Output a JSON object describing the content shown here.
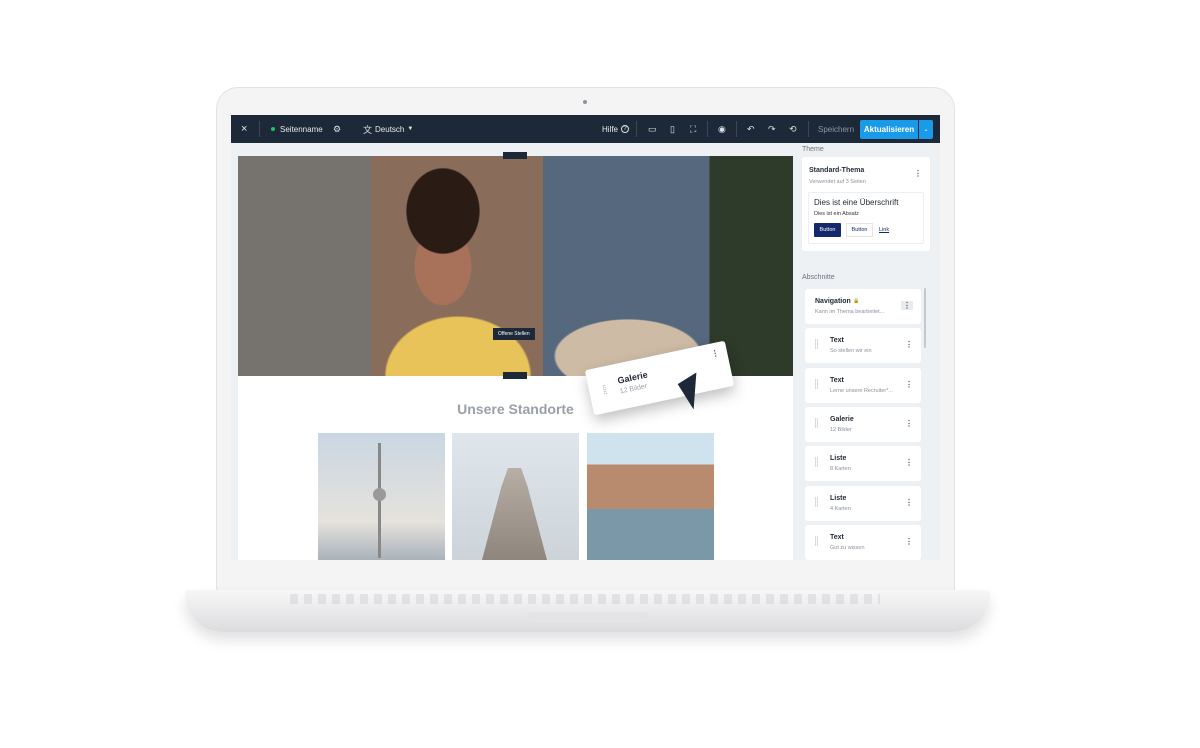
{
  "topbar": {
    "close": "×",
    "page_name": "Seitenname",
    "language": "Deutsch",
    "help": "Hilfe",
    "save": "Speichern",
    "update": "Aktualisieren",
    "status_color": "#22c55e"
  },
  "hero": {
    "tag": "Offene Stellen"
  },
  "content": {
    "heading": "Unsere Standorte"
  },
  "dragging": {
    "title": "Galerie",
    "subtitle": "12 Bilder"
  },
  "sidebar": {
    "theme_label": "Theme",
    "theme": {
      "name": "Standard-Thema",
      "used": "Verwendet auf 3 Seiten",
      "preview_heading": "Dies ist eine Überschrift",
      "preview_paragraph": "Dies ist ein Absatz",
      "primary_button": "Button",
      "secondary_button": "Button",
      "link": "Link"
    },
    "sections_label": "Abschnitte",
    "sections": [
      {
        "title": "Navigation",
        "subtitle": "Kann im Thema bearbeitet..."
      },
      {
        "title": "Text",
        "subtitle": "So stellen wir ein"
      },
      {
        "title": "Text",
        "subtitle": "Lerne unsere Recruiter*..."
      },
      {
        "title": "Galerie",
        "subtitle": "12 Bilder"
      },
      {
        "title": "Liste",
        "subtitle": "8 Karten"
      },
      {
        "title": "Liste",
        "subtitle": "4 Karten"
      },
      {
        "title": "Text",
        "subtitle": "Gut zu wissen"
      }
    ]
  },
  "colors": {
    "topbar": "#1d2939",
    "accent": "#1a9bea",
    "primary": "#14296b"
  }
}
